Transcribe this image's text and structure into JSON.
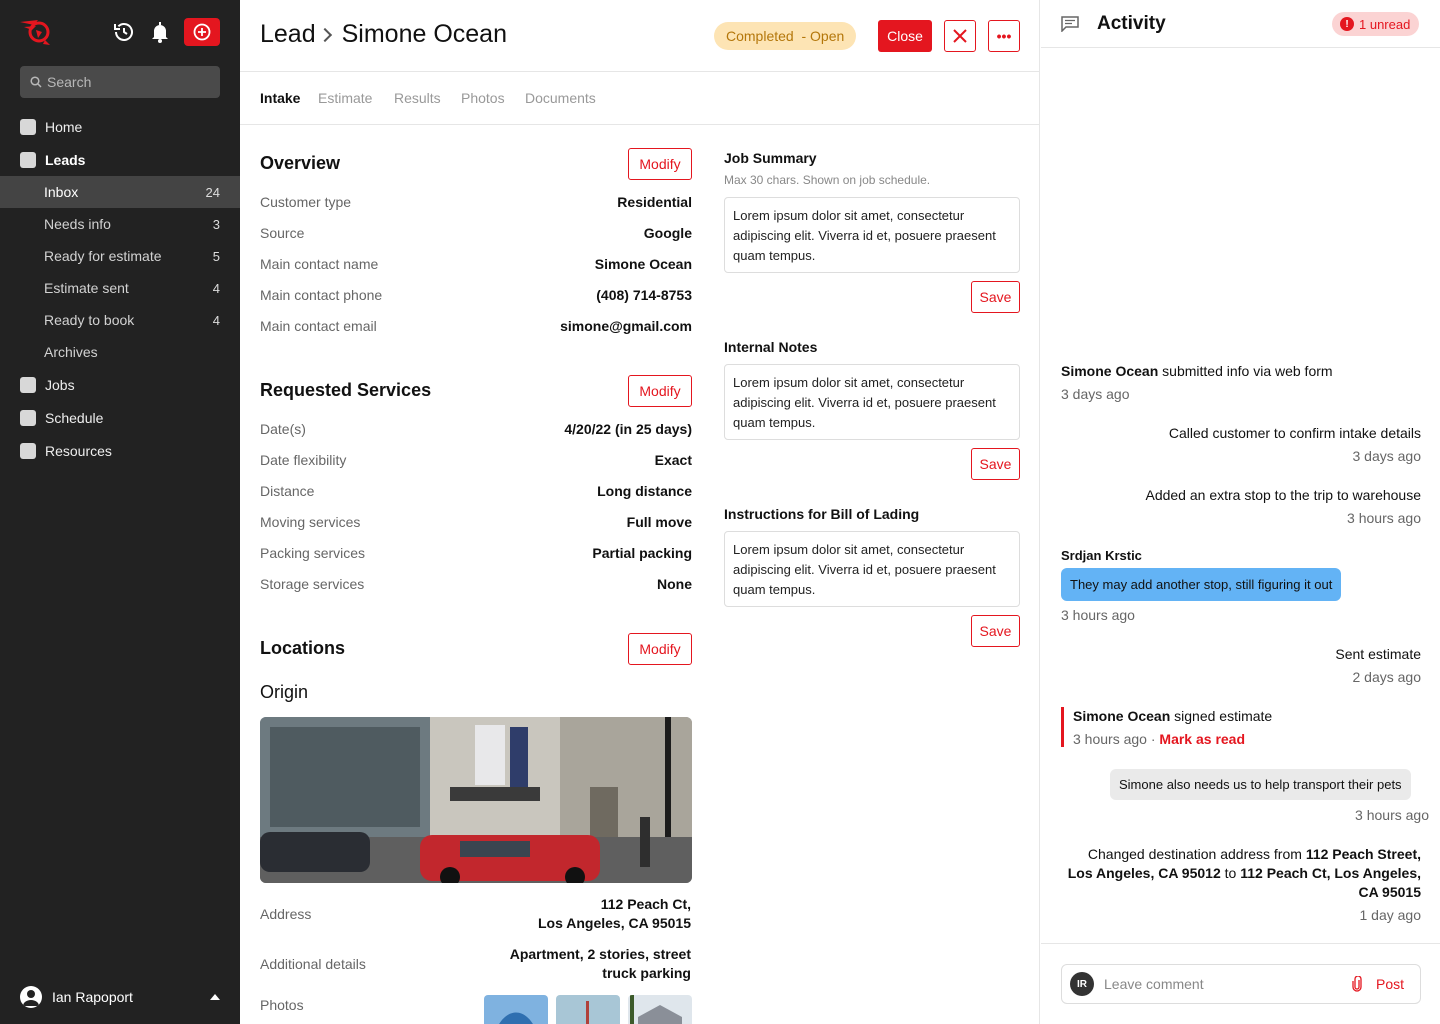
{
  "sidebar": {
    "search_placeholder": "Search",
    "nav_top": [
      {
        "label": "Home"
      },
      {
        "label": "Leads"
      },
      {
        "label": "Jobs"
      },
      {
        "label": "Schedule"
      },
      {
        "label": "Resources"
      }
    ],
    "leads_sub": [
      {
        "label": "Inbox",
        "count": "24"
      },
      {
        "label": "Needs info",
        "count": "3"
      },
      {
        "label": "Ready for estimate",
        "count": "5"
      },
      {
        "label": "Estimate sent",
        "count": "4"
      },
      {
        "label": "Ready to book",
        "count": "4"
      },
      {
        "label": "Archives",
        "count": ""
      }
    ],
    "user_name": "Ian Rapoport"
  },
  "header": {
    "crumb_root": "Lead",
    "crumb_name": "Simone Ocean",
    "status": "Completed  - Open",
    "close_label": "Close",
    "more_label": "•••"
  },
  "tabs": [
    "Intake",
    "Estimate",
    "Results",
    "Photos",
    "Documents"
  ],
  "overview": {
    "title": "Overview",
    "modify": "Modify",
    "rows": [
      {
        "k": "Customer type",
        "v": "Residential"
      },
      {
        "k": "Source",
        "v": "Google"
      },
      {
        "k": "Main contact name",
        "v": "Simone Ocean"
      },
      {
        "k": "Main contact phone",
        "v": "(408) 714-8753"
      },
      {
        "k": "Main contact email",
        "v": "simone@gmail.com"
      }
    ]
  },
  "services": {
    "title": "Requested Services",
    "modify": "Modify",
    "rows": [
      {
        "k": "Date(s)",
        "v": "4/20/22 (in 25 days)"
      },
      {
        "k": "Date flexibility",
        "v": "Exact"
      },
      {
        "k": "Distance",
        "v": "Long distance"
      },
      {
        "k": "Moving services",
        "v": "Full move"
      },
      {
        "k": "Packing services",
        "v": "Partial packing"
      },
      {
        "k": "Storage services",
        "v": "None"
      }
    ]
  },
  "locations": {
    "title": "Locations",
    "modify": "Modify",
    "origin": "Origin",
    "address_label": "Address",
    "address_line1": "112 Peach Ct,",
    "address_line2": "Los Angeles, CA 95015",
    "details_label": "Additional details",
    "details_line1": "Apartment, 2 stories, street",
    "details_line2": "truck parking",
    "photos_label": "Photos"
  },
  "notes": {
    "job_summary_label": "Job Summary",
    "job_summary_hint": "Max 30 chars. Shown on job schedule.",
    "internal_label": "Internal Notes",
    "bol_label": "Instructions for Bill of Lading",
    "lorem": "Lorem ipsum dolor sit amet, consectetur adipiscing elit. Viverra id et, posuere praesent quam tempus.",
    "save": "Save"
  },
  "activity": {
    "title": "Activity",
    "unread": "1 unread",
    "e1_name": "Simone Ocean",
    "e1_text": " submitted info via web form",
    "e1_time": "3 days ago",
    "e2_text": "Called customer to confirm intake details",
    "e2_time": "3 days ago",
    "e3_text": "Added an extra stop to the trip to warehouse",
    "e3_time": "3 hours ago",
    "e4_name": "Srdjan Krstic",
    "e4_msg": "They may add another stop, still figuring it out",
    "e4_time": "3 hours ago",
    "e5_text": "Sent estimate",
    "e5_time": "2 days ago",
    "e6_name": "Simone Ocean",
    "e6_text": " signed estimate",
    "e6_time": "3 hours ago",
    "e6_sep": " · ",
    "e6_mark": "Mark as read",
    "e7_msg": "Simone also needs us to help transport their pets",
    "e7_time": "3 hours ago",
    "e8_pre": "Changed destination address from ",
    "e8_from": "112 Peach Street, Los Angeles, CA 95012",
    "e8_mid": " to ",
    "e8_to": "112 Peach Ct, Los Angeles, CA 95015",
    "e8_time": "1 day ago",
    "comment_initials": "IR",
    "comment_placeholder": "Leave comment",
    "post": "Post"
  },
  "colors": {
    "accent": "#e4161f",
    "sidebar": "#222222",
    "status_bg": "#fde4b4",
    "bubble": "#63b3f5"
  }
}
